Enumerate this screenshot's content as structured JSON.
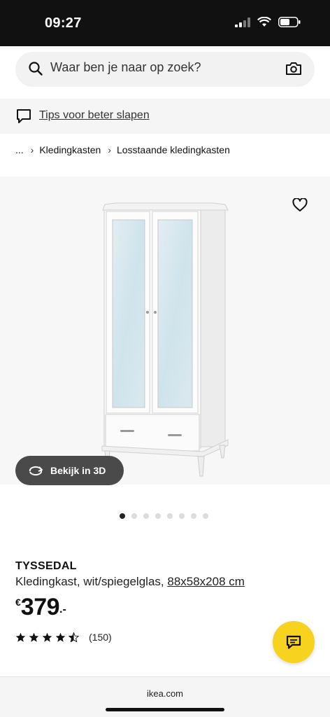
{
  "status_bar": {
    "time": "09:27"
  },
  "search": {
    "placeholder": "Waar ben je naar op zoek?"
  },
  "tips": {
    "label": "Tips voor beter slapen"
  },
  "breadcrumb": {
    "items": [
      "...",
      "Kledingkasten",
      "Losstaande kledingkasten"
    ]
  },
  "gallery": {
    "view_3d_label": "Bekijk in 3D",
    "image_count": 8,
    "active_index": 0
  },
  "product": {
    "name": "TYSSEDAL",
    "description": "Kledingkast, wit/spiegelglas,",
    "dimensions": "88x58x208 cm",
    "price_currency": "€",
    "price_value": "379",
    "price_suffix": ".-",
    "rating": 4.5,
    "review_count": "(150)"
  },
  "footer": {
    "url": "ikea.com"
  },
  "colors": {
    "chat_button": "#f7d21e",
    "status_bar": "#111111",
    "view_3d_button": "#4a4a4a"
  }
}
